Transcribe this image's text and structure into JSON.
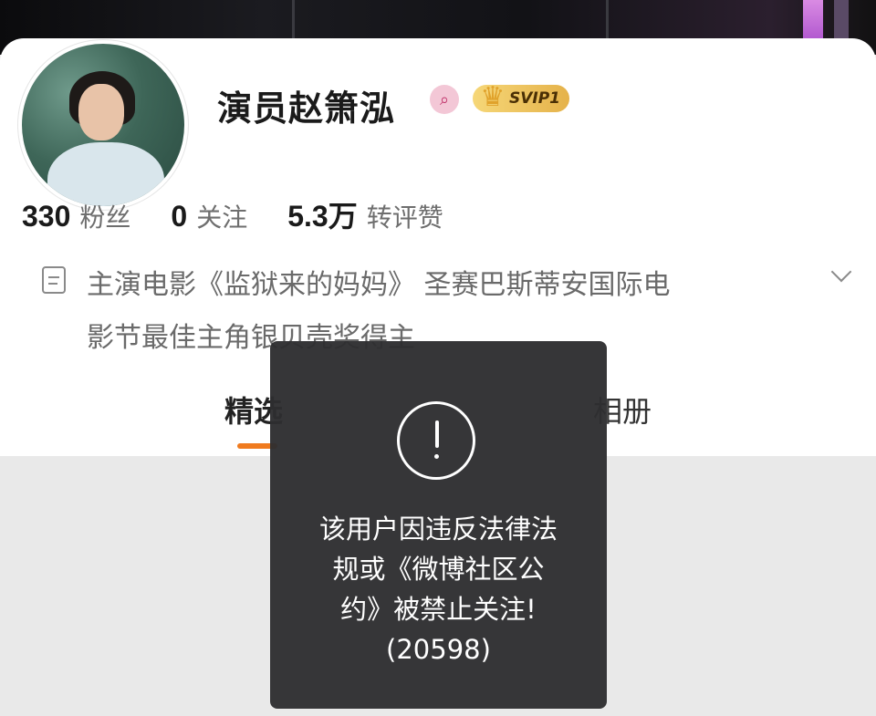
{
  "profile": {
    "name": "演员赵箫泓",
    "verify_icon": "search-badge-icon",
    "vip_badge": "SVIP1",
    "stats": [
      {
        "value": "330",
        "label": "粉丝"
      },
      {
        "value": "0",
        "label": "关注"
      },
      {
        "value": "5.3万",
        "label": "转评赞"
      }
    ],
    "bio_line1": "主演电影《监狱来的妈妈》 圣赛巴斯蒂安国际电",
    "bio_line2": "影节最佳主角银贝壳奖得主"
  },
  "tabs": {
    "active_partial": "精选",
    "album_partial": "相册"
  },
  "toast": {
    "line1": "该用户因违反法律法",
    "line2": "规或《微博社区公",
    "line3": "约》被禁止关注!",
    "code": "(20598)"
  },
  "colors": {
    "accent": "#f07b1f",
    "toast_bg": "#2e2e30",
    "vip_gold": "#e5b24a"
  }
}
